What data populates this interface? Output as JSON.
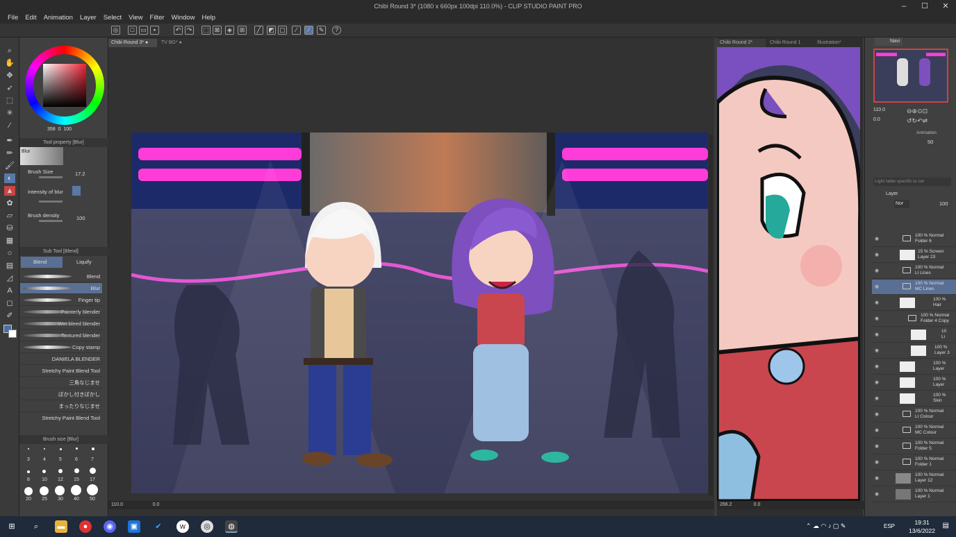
{
  "window": {
    "title": "Chibi Round 3* (1080 x 660px 100dpi 110.0%) - CLIP STUDIO PAINT PRO"
  },
  "menu": [
    "File",
    "Edit",
    "Animation",
    "Layer",
    "Select",
    "View",
    "Filter",
    "Window",
    "Help"
  ],
  "color_wheel": {
    "h": "358",
    "s": "0",
    "v": "100",
    "main_color": "#3a1f22"
  },
  "tool_property": {
    "title": "Tool property [Blur]",
    "tool_name": "Blur",
    "brush_size_label": "Brush Size",
    "brush_size_value": "17.2",
    "intensity_label": "Intensity of blur",
    "density_label": "Brush density",
    "density_value": "100"
  },
  "sub_tool": {
    "title": "Sub Tool [Blend]",
    "tabs": [
      "Blend",
      "Liquify"
    ],
    "items": [
      "Blend",
      "Blur",
      "Finger tip",
      "Painterly blender",
      "Wet bleed blender",
      "Textured blender",
      "Copy stamp",
      "DANIELA BLENDER",
      "Stretchy Paint Blend Tool",
      "三角なじませ",
      "ぼかし付きぼかし",
      "まったりなじませ",
      "Stretchy Paint Blend Tool"
    ]
  },
  "brush_size": {
    "title": "Brush size [Blur]",
    "sizes": [
      "3",
      "4",
      "5",
      "6",
      "7",
      "8",
      "10",
      "12",
      "15",
      "17",
      "20",
      "25",
      "30",
      "40",
      "50"
    ]
  },
  "canvas": {
    "tabs": [
      "Chibi Round 3*",
      "TV BG*"
    ],
    "zoom": "110.0",
    "angle": "0.0"
  },
  "subview": {
    "tabs": [
      "Chibi Round 2*",
      "Chibi Round 1",
      "Illustration*"
    ],
    "zoom": "266.2",
    "angle": "0.0"
  },
  "navigator": {
    "tab": "Navi",
    "zoom": "110.0",
    "angle": "0.0"
  },
  "animation": {
    "tab": "Animation",
    "opacity": "50",
    "placeholder": "Light table specific to cel"
  },
  "layers": {
    "tab": "Layer",
    "blend_mode": "Nor",
    "opacity": "100",
    "items": [
      {
        "pct": "100 %",
        "mode": "Normal",
        "name": "Folder 6",
        "kind": "folder"
      },
      {
        "pct": "15 %",
        "mode": "Screen",
        "name": "Layer 23",
        "kind": "layer"
      },
      {
        "pct": "100 %",
        "mode": "Normal",
        "name": "LI Lines",
        "kind": "folder"
      },
      {
        "pct": "100 %",
        "mode": "Normal",
        "name": "MC Lines",
        "kind": "folder"
      },
      {
        "pct": "100 %",
        "mode": "",
        "name": "Hair",
        "kind": "layer"
      },
      {
        "pct": "100 %",
        "mode": "Normal",
        "name": "Folder 4 Copy",
        "kind": "folder"
      },
      {
        "pct": "10",
        "mode": "",
        "name": "Li",
        "kind": "layer"
      },
      {
        "pct": "100 %",
        "mode": "",
        "name": "Layer 3",
        "kind": "layer"
      },
      {
        "pct": "100 %",
        "mode": "",
        "name": "Layer",
        "kind": "layer"
      },
      {
        "pct": "100 %",
        "mode": "",
        "name": "Layer",
        "kind": "layer"
      },
      {
        "pct": "100 %",
        "mode": "",
        "name": "Skin",
        "kind": "layer"
      },
      {
        "pct": "100 %",
        "mode": "Normal",
        "name": "LI Colour",
        "kind": "folder"
      },
      {
        "pct": "100 %",
        "mode": "Normal",
        "name": "MC Colour",
        "kind": "folder"
      },
      {
        "pct": "100 %",
        "mode": "Normal",
        "name": "Folder 5",
        "kind": "folder"
      },
      {
        "pct": "100 %",
        "mode": "Normal",
        "name": "Folder 1",
        "kind": "folder"
      },
      {
        "pct": "100 %",
        "mode": "Normal",
        "name": "Layer 12",
        "kind": "layer"
      },
      {
        "pct": "100 %",
        "mode": "Normal",
        "name": "Layer 1",
        "kind": "layer"
      }
    ]
  },
  "taskbar": {
    "time": "19:31",
    "date": "13/6/2022",
    "lang": "ESP"
  }
}
